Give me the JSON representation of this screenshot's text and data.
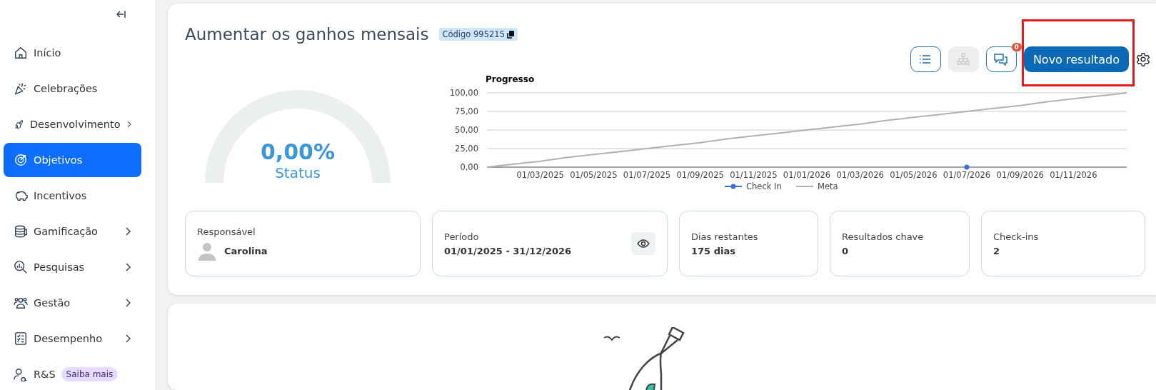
{
  "sidebar": {
    "items": [
      {
        "label": "Início",
        "has_submenu": false,
        "selected": false
      },
      {
        "label": "Celebrações",
        "has_submenu": false,
        "selected": false
      },
      {
        "label": "Desenvolvimento",
        "has_submenu": true,
        "selected": false
      },
      {
        "label": "Objetivos",
        "has_submenu": false,
        "selected": true
      },
      {
        "label": "Incentivos",
        "has_submenu": false,
        "selected": false
      },
      {
        "label": "Gamificação",
        "has_submenu": true,
        "selected": false
      },
      {
        "label": "Pesquisas",
        "has_submenu": true,
        "selected": false
      },
      {
        "label": "Gestão",
        "has_submenu": true,
        "selected": false
      },
      {
        "label": "Desempenho",
        "has_submenu": true,
        "selected": false
      },
      {
        "label": "R&S",
        "has_submenu": false,
        "selected": false,
        "badge": "Saiba mais"
      }
    ]
  },
  "objective": {
    "title": "Aumentar os ganhos mensais",
    "code": "Código 995215",
    "toolbar": [
      {
        "kind": "list",
        "disabled": false
      },
      {
        "kind": "hierarchy",
        "disabled": true
      },
      {
        "kind": "comments",
        "disabled": false,
        "badge": "0"
      }
    ],
    "primary_button": "Novo resultado",
    "highlighted": true,
    "gauge": {
      "value": "0,00%",
      "label": "Status"
    },
    "chart_data": {
      "type": "line",
      "title": "Progresso",
      "categories": [
        null,
        null,
        "01/03/2025",
        null,
        "01/05/2025",
        null,
        "01/07/2025",
        null,
        "01/09/2025",
        null,
        "01/11/2025",
        null,
        "01/01/2026",
        null,
        "01/03/2026",
        null,
        "01/05/2026",
        null,
        "01/07/2026",
        null,
        "01/09/2026",
        null,
        "01/11/2026",
        null,
        null
      ],
      "grid": true,
      "legend": true,
      "series": [
        {
          "name": "Check In",
          "color": "#3b6fd4",
          "marker": "circle",
          "values": [
            null,
            null,
            null,
            null,
            null,
            null,
            null,
            null,
            null,
            null,
            null,
            null,
            null,
            null,
            null,
            null,
            null,
            null,
            0,
            null,
            null,
            null,
            null,
            null,
            null
          ]
        },
        {
          "name": "Meta",
          "color": "#b0b0b0",
          "values": [
            0,
            4,
            8,
            13,
            17,
            21,
            25,
            29,
            33,
            38,
            42,
            46,
            50,
            54,
            58,
            63,
            67,
            71,
            75,
            79,
            83,
            88,
            92,
            96,
            100
          ]
        }
      ],
      "ylim": [
        0,
        100
      ],
      "yticks": [
        {
          "value": 0,
          "label": "0,00"
        },
        {
          "value": 25,
          "label": "25,00"
        },
        {
          "value": 50,
          "label": "50,00"
        },
        {
          "value": 75,
          "label": "75,00"
        },
        {
          "value": 100,
          "label": "100,00"
        }
      ]
    },
    "info_cards": [
      {
        "kind": "person",
        "label": "Responsável",
        "value": "Carolina"
      },
      {
        "kind": "period",
        "label": "Período",
        "value": "01/01/2025 - 31/12/2026"
      },
      {
        "kind": "plain",
        "label": "Dias restantes",
        "value": "175 dias"
      },
      {
        "kind": "plain",
        "label": "Resultados chave",
        "value": "0"
      },
      {
        "kind": "plain",
        "label": "Check-ins",
        "value": "2"
      }
    ]
  }
}
